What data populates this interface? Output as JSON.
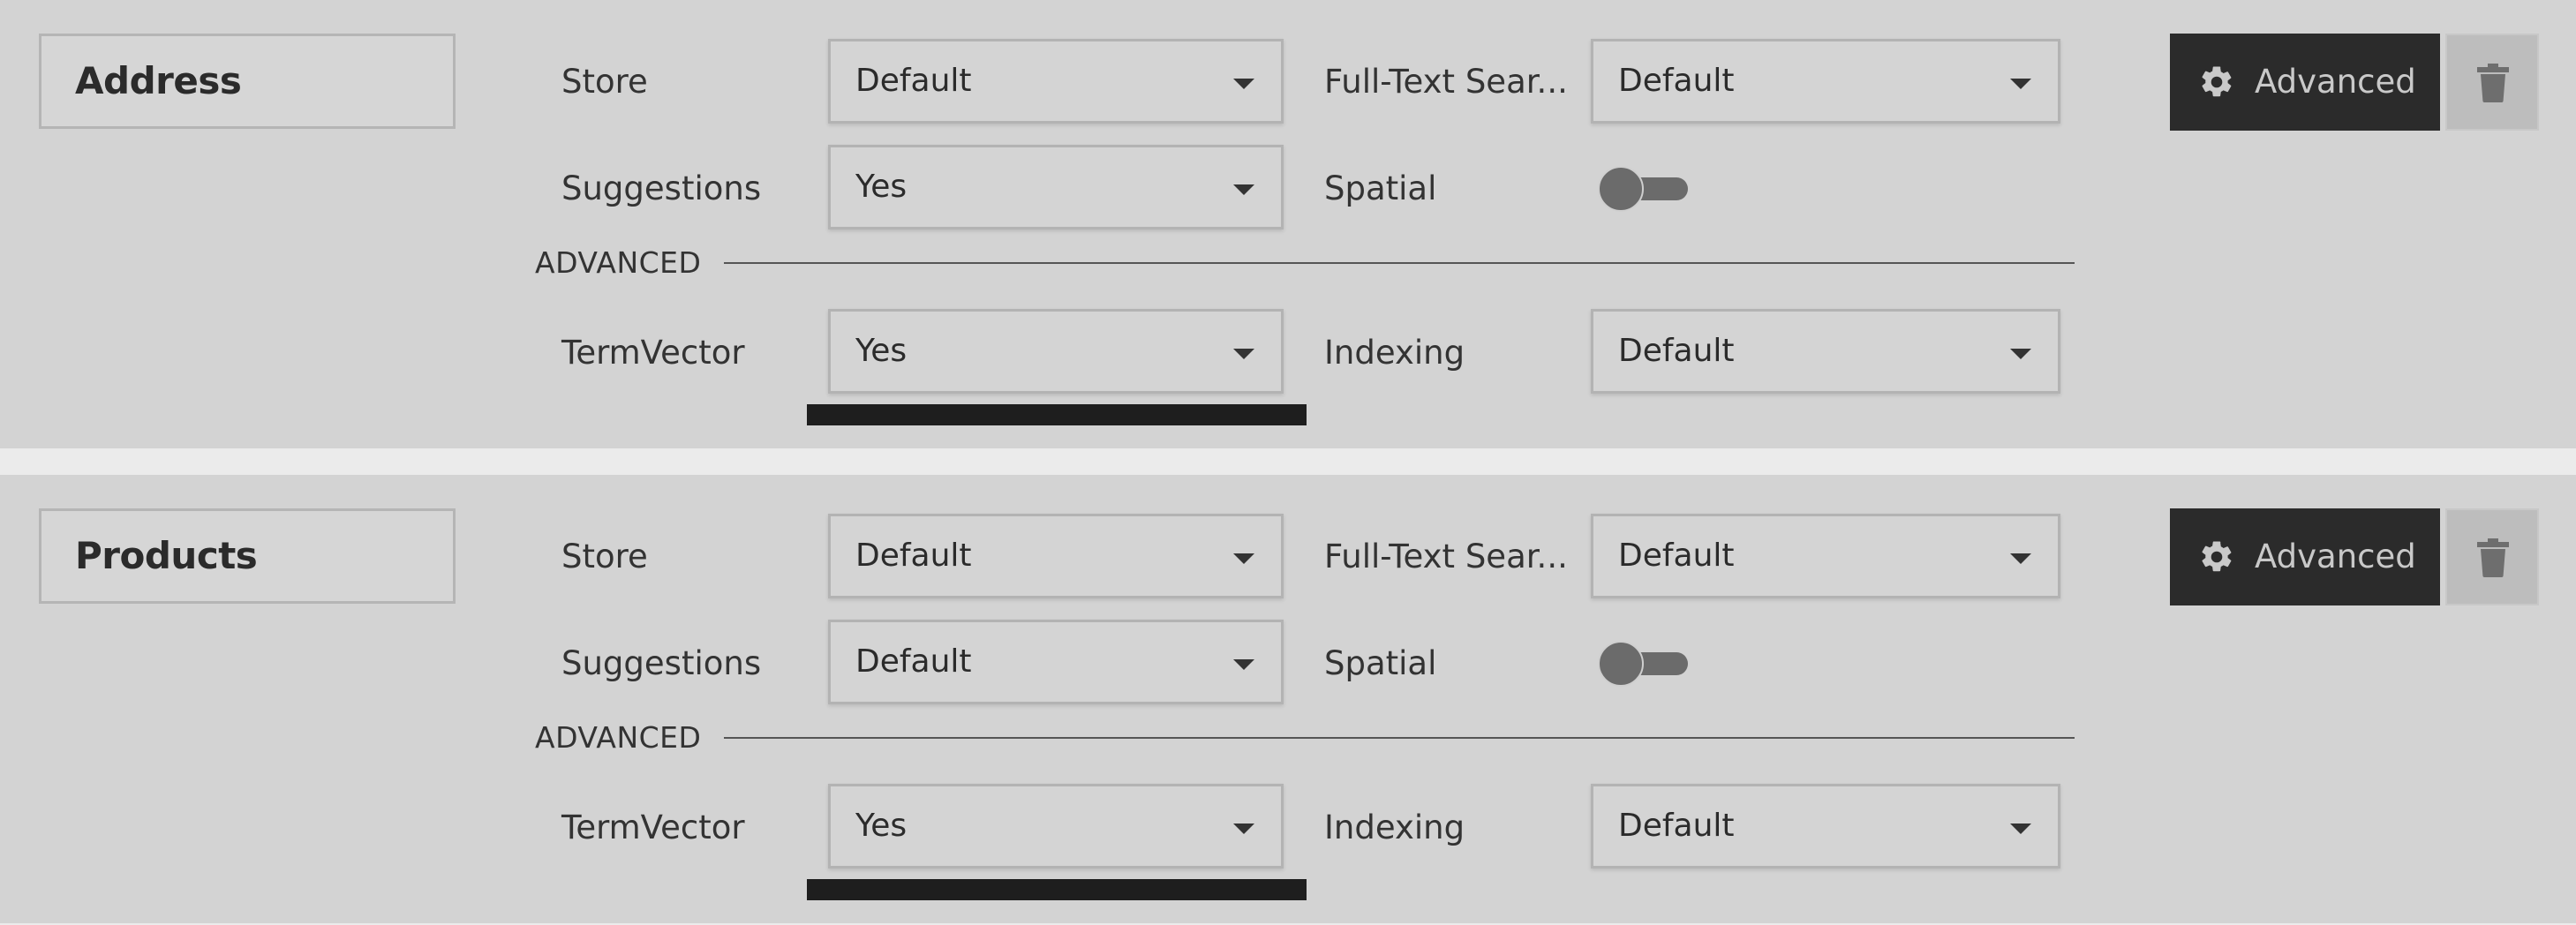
{
  "fields": [
    {
      "name": "Address",
      "store": {
        "label": "Store",
        "value": "Default"
      },
      "full_text_search": {
        "label": "Full-Text Sear...",
        "value": "Default"
      },
      "suggestions": {
        "label": "Suggestions",
        "value": "Yes"
      },
      "spatial": {
        "label": "Spatial",
        "enabled": false
      },
      "advanced_heading": "ADVANCED",
      "term_vector": {
        "label": "TermVector",
        "value": "Yes"
      },
      "indexing": {
        "label": "Indexing",
        "value": "Default"
      },
      "advanced_button": {
        "label": "Advanced",
        "icon": "gear-icon"
      },
      "delete_button": {
        "icon": "trash-icon"
      }
    },
    {
      "name": "Products",
      "store": {
        "label": "Store",
        "value": "Default"
      },
      "full_text_search": {
        "label": "Full-Text Sear...",
        "value": "Default"
      },
      "suggestions": {
        "label": "Suggestions",
        "value": "Default"
      },
      "spatial": {
        "label": "Spatial",
        "enabled": false
      },
      "advanced_heading": "ADVANCED",
      "term_vector": {
        "label": "TermVector",
        "value": "Yes"
      },
      "indexing": {
        "label": "Indexing",
        "value": "Default"
      },
      "advanced_button": {
        "label": "Advanced",
        "icon": "gear-icon"
      },
      "delete_button": {
        "icon": "trash-icon"
      }
    }
  ],
  "colors": {
    "section_bg": "#d3d3d3",
    "page_bg": "#ebebeb",
    "advanced_button_bg": "#2b2b2b",
    "delete_button_bg": "#bdbdbd",
    "toggle_off": "#6b6b6b"
  }
}
